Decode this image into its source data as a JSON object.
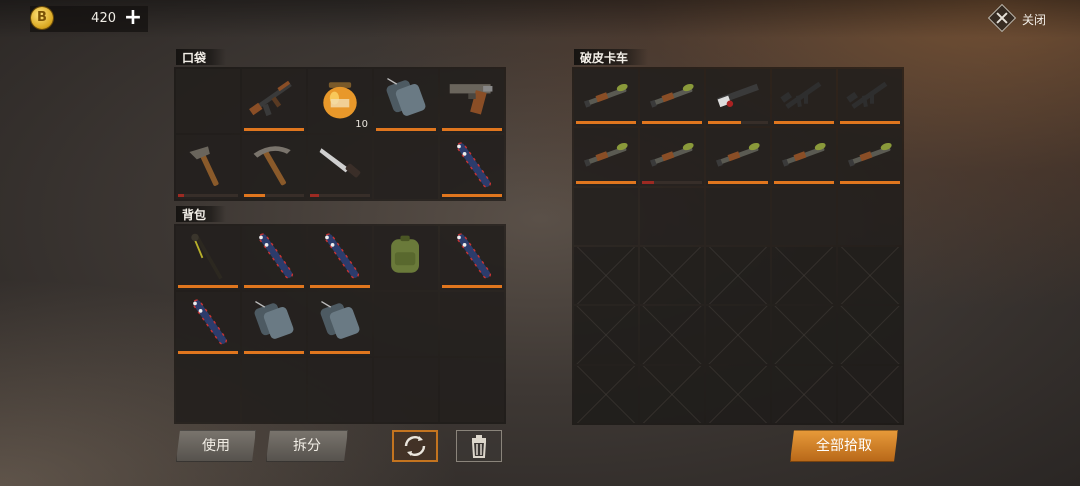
{
  "header": {
    "coins": "420",
    "coin_glyph": "B",
    "add_glyph": "+",
    "close_label": "关闭"
  },
  "pocket": {
    "title": "口袋",
    "slots": [
      {
        "icon": "empty"
      },
      {
        "icon": "ak-rifle-icon",
        "durability": 1.0
      },
      {
        "icon": "honey-jar-icon",
        "qty": "10"
      },
      {
        "icon": "dog-tags-icon",
        "durability": 1.0
      },
      {
        "icon": "pistol-icon",
        "durability": 1.0
      },
      {
        "icon": "stone-hoe-icon",
        "durability": 0.1,
        "color": "red"
      },
      {
        "icon": "stone-pickaxe-icon",
        "durability": 0.35
      },
      {
        "icon": "combat-knife-icon",
        "durability": 0.15,
        "color": "red"
      },
      {
        "icon": "empty"
      },
      {
        "icon": "baseball-bat-icon",
        "durability": 1.0
      }
    ]
  },
  "backpack": {
    "title": "背包",
    "slots": [
      {
        "icon": "spiked-club-icon",
        "durability": 1.0
      },
      {
        "icon": "baseball-bat-icon",
        "durability": 1.0
      },
      {
        "icon": "baseball-bat-icon",
        "durability": 1.0
      },
      {
        "icon": "backpack-icon"
      },
      {
        "icon": "baseball-bat-icon",
        "durability": 1.0
      },
      {
        "icon": "baseball-bat-icon",
        "durability": 1.0
      },
      {
        "icon": "dog-tags-icon",
        "durability": 1.0
      },
      {
        "icon": "dog-tags-icon",
        "durability": 1.0
      },
      {
        "icon": "empty"
      },
      {
        "icon": "empty"
      },
      {
        "icon": "empty"
      },
      {
        "icon": "empty"
      },
      {
        "icon": "empty"
      },
      {
        "icon": "empty"
      },
      {
        "icon": "empty"
      }
    ]
  },
  "truck": {
    "title": "破皮卡车",
    "slots": [
      {
        "icon": "rpg-launcher-icon",
        "durability": 1.0
      },
      {
        "icon": "rpg-launcher-icon",
        "durability": 1.0
      },
      {
        "icon": "minigun-icon",
        "durability": 0.55
      },
      {
        "icon": "assault-rifle-icon",
        "durability": 1.0
      },
      {
        "icon": "assault-rifle-icon",
        "durability": 1.0
      },
      {
        "icon": "rpg-launcher-icon",
        "durability": 1.0
      },
      {
        "icon": "rpg-launcher-icon",
        "durability": 0.2,
        "color": "red"
      },
      {
        "icon": "rpg-launcher-icon",
        "durability": 1.0
      },
      {
        "icon": "rpg-launcher-icon",
        "durability": 1.0
      },
      {
        "icon": "rpg-launcher-icon",
        "durability": 1.0
      }
    ],
    "empty_rows": 4
  },
  "actions": {
    "use": "使用",
    "split": "拆分",
    "take_all": "全部拾取"
  },
  "colors": {
    "accent": "#e0761e",
    "low_durability": "#9c2a22"
  }
}
